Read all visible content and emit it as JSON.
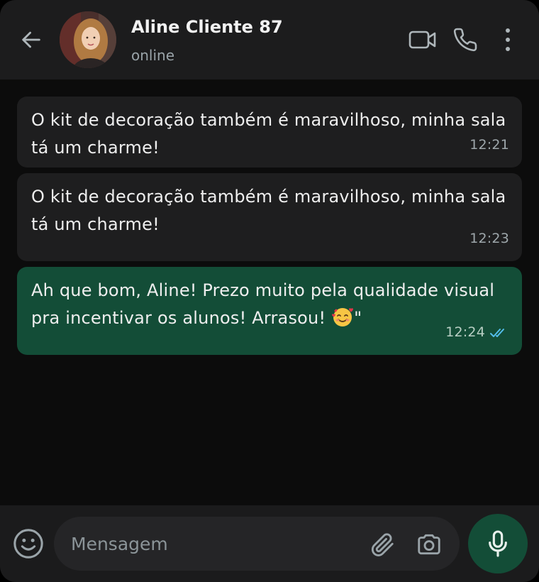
{
  "header": {
    "contact_name": "Aline Cliente 87",
    "status": "online",
    "icons": {
      "back": "arrow-left-icon",
      "video": "video-camera-icon",
      "call": "phone-icon",
      "menu": "more-vertical-icon"
    }
  },
  "messages": [
    {
      "direction": "incoming",
      "text": "O kit de decoração também é maravilhoso, minha sala tá um charme!",
      "time": "12:21"
    },
    {
      "direction": "incoming",
      "text": "O kit de decoração também é maravilhoso, minha sala tá um charme!",
      "time": "12:23"
    },
    {
      "direction": "outgoing",
      "text": "Ah que bom, Aline! Prezo muito pela qualidade visual pra incentivar os alunos! Arrasou!",
      "emoji": "smiling-face-with-hearts-emoji",
      "trailing": "\"",
      "time": "12:24",
      "read_status": "double-check-icon"
    }
  ],
  "composer": {
    "placeholder": "Mensagem",
    "value": "",
    "icons": {
      "emoji": "emoji-face-icon",
      "attach": "paperclip-icon",
      "camera": "camera-icon",
      "mic": "microphone-icon"
    }
  },
  "colors": {
    "header_bg": "#1c1c1d",
    "chat_bg": "#0c0c0c",
    "incoming_bubble": "#1e1e1f",
    "outgoing_bubble": "#134d37",
    "read_tick": "#53bdeb",
    "accent": "#134d37"
  }
}
